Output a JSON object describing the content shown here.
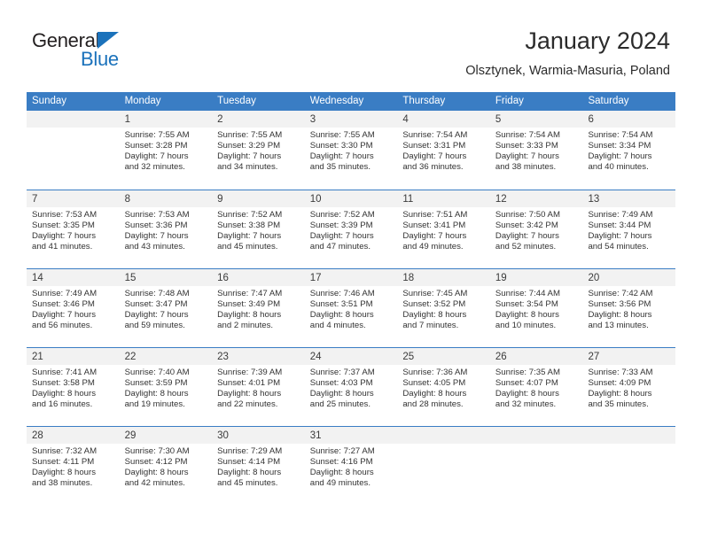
{
  "brand": {
    "name_top": "General",
    "name_bottom": "Blue",
    "triangle_color": "#1b72bb"
  },
  "header": {
    "title": "January 2024",
    "subtitle": "Olsztynek, Warmia-Masuria, Poland",
    "header_bg": "#3a7dc4",
    "day_band_bg": "#f2f2f2"
  },
  "weekdays": [
    "Sunday",
    "Monday",
    "Tuesday",
    "Wednesday",
    "Thursday",
    "Friday",
    "Saturday"
  ],
  "weeks": [
    [
      {
        "date": "",
        "sunrise": "",
        "sunset": "",
        "daylight_line1": "",
        "daylight_line2": ""
      },
      {
        "date": "1",
        "sunrise": "Sunrise: 7:55 AM",
        "sunset": "Sunset: 3:28 PM",
        "daylight_line1": "Daylight: 7 hours",
        "daylight_line2": "and 32 minutes."
      },
      {
        "date": "2",
        "sunrise": "Sunrise: 7:55 AM",
        "sunset": "Sunset: 3:29 PM",
        "daylight_line1": "Daylight: 7 hours",
        "daylight_line2": "and 34 minutes."
      },
      {
        "date": "3",
        "sunrise": "Sunrise: 7:55 AM",
        "sunset": "Sunset: 3:30 PM",
        "daylight_line1": "Daylight: 7 hours",
        "daylight_line2": "and 35 minutes."
      },
      {
        "date": "4",
        "sunrise": "Sunrise: 7:54 AM",
        "sunset": "Sunset: 3:31 PM",
        "daylight_line1": "Daylight: 7 hours",
        "daylight_line2": "and 36 minutes."
      },
      {
        "date": "5",
        "sunrise": "Sunrise: 7:54 AM",
        "sunset": "Sunset: 3:33 PM",
        "daylight_line1": "Daylight: 7 hours",
        "daylight_line2": "and 38 minutes."
      },
      {
        "date": "6",
        "sunrise": "Sunrise: 7:54 AM",
        "sunset": "Sunset: 3:34 PM",
        "daylight_line1": "Daylight: 7 hours",
        "daylight_line2": "and 40 minutes."
      }
    ],
    [
      {
        "date": "7",
        "sunrise": "Sunrise: 7:53 AM",
        "sunset": "Sunset: 3:35 PM",
        "daylight_line1": "Daylight: 7 hours",
        "daylight_line2": "and 41 minutes."
      },
      {
        "date": "8",
        "sunrise": "Sunrise: 7:53 AM",
        "sunset": "Sunset: 3:36 PM",
        "daylight_line1": "Daylight: 7 hours",
        "daylight_line2": "and 43 minutes."
      },
      {
        "date": "9",
        "sunrise": "Sunrise: 7:52 AM",
        "sunset": "Sunset: 3:38 PM",
        "daylight_line1": "Daylight: 7 hours",
        "daylight_line2": "and 45 minutes."
      },
      {
        "date": "10",
        "sunrise": "Sunrise: 7:52 AM",
        "sunset": "Sunset: 3:39 PM",
        "daylight_line1": "Daylight: 7 hours",
        "daylight_line2": "and 47 minutes."
      },
      {
        "date": "11",
        "sunrise": "Sunrise: 7:51 AM",
        "sunset": "Sunset: 3:41 PM",
        "daylight_line1": "Daylight: 7 hours",
        "daylight_line2": "and 49 minutes."
      },
      {
        "date": "12",
        "sunrise": "Sunrise: 7:50 AM",
        "sunset": "Sunset: 3:42 PM",
        "daylight_line1": "Daylight: 7 hours",
        "daylight_line2": "and 52 minutes."
      },
      {
        "date": "13",
        "sunrise": "Sunrise: 7:49 AM",
        "sunset": "Sunset: 3:44 PM",
        "daylight_line1": "Daylight: 7 hours",
        "daylight_line2": "and 54 minutes."
      }
    ],
    [
      {
        "date": "14",
        "sunrise": "Sunrise: 7:49 AM",
        "sunset": "Sunset: 3:46 PM",
        "daylight_line1": "Daylight: 7 hours",
        "daylight_line2": "and 56 minutes."
      },
      {
        "date": "15",
        "sunrise": "Sunrise: 7:48 AM",
        "sunset": "Sunset: 3:47 PM",
        "daylight_line1": "Daylight: 7 hours",
        "daylight_line2": "and 59 minutes."
      },
      {
        "date": "16",
        "sunrise": "Sunrise: 7:47 AM",
        "sunset": "Sunset: 3:49 PM",
        "daylight_line1": "Daylight: 8 hours",
        "daylight_line2": "and 2 minutes."
      },
      {
        "date": "17",
        "sunrise": "Sunrise: 7:46 AM",
        "sunset": "Sunset: 3:51 PM",
        "daylight_line1": "Daylight: 8 hours",
        "daylight_line2": "and 4 minutes."
      },
      {
        "date": "18",
        "sunrise": "Sunrise: 7:45 AM",
        "sunset": "Sunset: 3:52 PM",
        "daylight_line1": "Daylight: 8 hours",
        "daylight_line2": "and 7 minutes."
      },
      {
        "date": "19",
        "sunrise": "Sunrise: 7:44 AM",
        "sunset": "Sunset: 3:54 PM",
        "daylight_line1": "Daylight: 8 hours",
        "daylight_line2": "and 10 minutes."
      },
      {
        "date": "20",
        "sunrise": "Sunrise: 7:42 AM",
        "sunset": "Sunset: 3:56 PM",
        "daylight_line1": "Daylight: 8 hours",
        "daylight_line2": "and 13 minutes."
      }
    ],
    [
      {
        "date": "21",
        "sunrise": "Sunrise: 7:41 AM",
        "sunset": "Sunset: 3:58 PM",
        "daylight_line1": "Daylight: 8 hours",
        "daylight_line2": "and 16 minutes."
      },
      {
        "date": "22",
        "sunrise": "Sunrise: 7:40 AM",
        "sunset": "Sunset: 3:59 PM",
        "daylight_line1": "Daylight: 8 hours",
        "daylight_line2": "and 19 minutes."
      },
      {
        "date": "23",
        "sunrise": "Sunrise: 7:39 AM",
        "sunset": "Sunset: 4:01 PM",
        "daylight_line1": "Daylight: 8 hours",
        "daylight_line2": "and 22 minutes."
      },
      {
        "date": "24",
        "sunrise": "Sunrise: 7:37 AM",
        "sunset": "Sunset: 4:03 PM",
        "daylight_line1": "Daylight: 8 hours",
        "daylight_line2": "and 25 minutes."
      },
      {
        "date": "25",
        "sunrise": "Sunrise: 7:36 AM",
        "sunset": "Sunset: 4:05 PM",
        "daylight_line1": "Daylight: 8 hours",
        "daylight_line2": "and 28 minutes."
      },
      {
        "date": "26",
        "sunrise": "Sunrise: 7:35 AM",
        "sunset": "Sunset: 4:07 PM",
        "daylight_line1": "Daylight: 8 hours",
        "daylight_line2": "and 32 minutes."
      },
      {
        "date": "27",
        "sunrise": "Sunrise: 7:33 AM",
        "sunset": "Sunset: 4:09 PM",
        "daylight_line1": "Daylight: 8 hours",
        "daylight_line2": "and 35 minutes."
      }
    ],
    [
      {
        "date": "28",
        "sunrise": "Sunrise: 7:32 AM",
        "sunset": "Sunset: 4:11 PM",
        "daylight_line1": "Daylight: 8 hours",
        "daylight_line2": "and 38 minutes."
      },
      {
        "date": "29",
        "sunrise": "Sunrise: 7:30 AM",
        "sunset": "Sunset: 4:12 PM",
        "daylight_line1": "Daylight: 8 hours",
        "daylight_line2": "and 42 minutes."
      },
      {
        "date": "30",
        "sunrise": "Sunrise: 7:29 AM",
        "sunset": "Sunset: 4:14 PM",
        "daylight_line1": "Daylight: 8 hours",
        "daylight_line2": "and 45 minutes."
      },
      {
        "date": "31",
        "sunrise": "Sunrise: 7:27 AM",
        "sunset": "Sunset: 4:16 PM",
        "daylight_line1": "Daylight: 8 hours",
        "daylight_line2": "and 49 minutes."
      },
      {
        "date": "",
        "sunrise": "",
        "sunset": "",
        "daylight_line1": "",
        "daylight_line2": ""
      },
      {
        "date": "",
        "sunrise": "",
        "sunset": "",
        "daylight_line1": "",
        "daylight_line2": ""
      },
      {
        "date": "",
        "sunrise": "",
        "sunset": "",
        "daylight_line1": "",
        "daylight_line2": ""
      }
    ]
  ]
}
